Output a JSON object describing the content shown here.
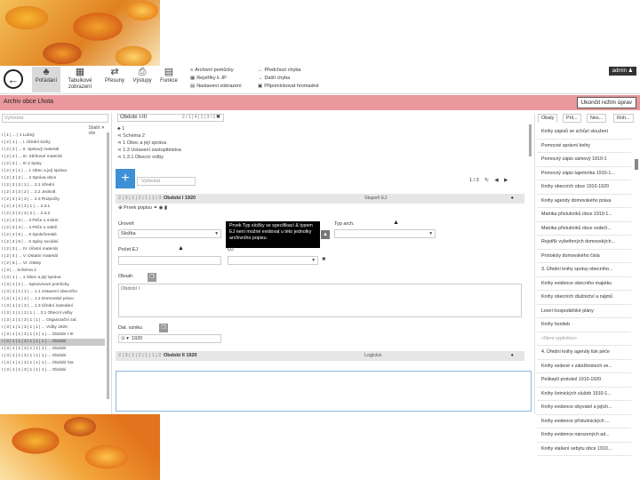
{
  "toolbar": {
    "buttons": [
      {
        "label": "Pořádání",
        "icon": "hierarchy-icon"
      },
      {
        "label": "Tabulkové zobrazení",
        "icon": "table-icon"
      },
      {
        "label": "Přesuny",
        "icon": "transfer-icon"
      },
      {
        "label": "Výstupy",
        "icon": "printer-icon"
      },
      {
        "label": "Funkce",
        "icon": "calculator-icon"
      }
    ],
    "links": [
      {
        "label": "Archivní pomůcky"
      },
      {
        "label": "Rejstříky k JP"
      },
      {
        "label": "Nastavení zobrazení"
      },
      {
        "label": "Předchozí chyba"
      },
      {
        "label": "Další chyba"
      },
      {
        "label": "Připomínkovat hromadně"
      }
    ],
    "user": "admin"
  },
  "titlebar": {
    "title": "Archiv obce Lhota",
    "end_edit": "Ukončit režim úprav"
  },
  "tree": {
    "search_placeholder": "Vyhledat",
    "collapse_label": "Sbalit vše",
    "rows": [
      "I | 1 | ... | 1 Lubný",
      "I | 2 | 1 | ... I. Úřední knihy",
      "I | 2 | 2 | ... II. Spisový materiál",
      "I | 2 | 2 | ... III. Sbírkové materiál",
      "I | 2 | 2 | ... III 2 Spisy",
      "I | 2 | 2 | 1 | ... 1 Obec a její správa",
      "I | 2 | 2 | 2 | ... 2 Správa obce",
      "I | 2 | 2 | 2 | 1 | ... 2.1 Úřední",
      "I | 2 | 2 | 2 | 2 | ... 2.2 Jednotl.",
      "I | 2 | 2 | 2 | 3 | ... 2.3 Rozpočty",
      "I | 2 | 2 | 2 | 3 | 1 | ... 2.3.1",
      "I | 2 | 2 | 2 | 3 | 2 | ... 2.3.2",
      "I | 2 | 2 | 3 | ... 3 Péče o místní",
      "I | 2 | 2 | 4 | ... 4 Péče o nálež.",
      "I | 2 | 2 | 5 | ... 5 Společenské",
      "I | 2 | 2 | 6 | ... 6 Spisy sociální",
      "I | 2 | 3 | ... IV. Účetní materiál",
      "I | 2 | 4 | ... V. Ostatní materiál",
      "I | 2 | 5 | ... VI. Otisky",
      "I | 3 | ... Schéma 2",
      "I | 3 | 1 | ... 1 Obec a její správa",
      "I | 3 | 1 | 1 | ... Spisovnové pomůcky",
      "I | 3 | 1 | 1 | 1 | ... 1.1 Ustavení obecního",
      "I | 3 | 1 | 1 | 2 | ... 1.2 Domovské právo",
      "I | 3 | 1 | 1 | 3 | ... 1.3 Úřední zasedání",
      "I | 3 | 1 | 1 | 3 | 1 | ... 3.1 Obecní volby",
      "I | 3 | 1 | 1 | 3 | 1 | 1 | ... Organizační zal.",
      "I | 3 | 1 | 1 | 3 | 1 | 1 | ... Volby 1920",
      "I | 3 | 1 | 1 | 3 | 1 | 1 | 1 | ... Období I-III",
      "I | 3 | 1 | 1 | 3 | 1 | 1 | 1 | ... Období",
      "I | 3 | 1 | 1 | 3 | 1 | 1 | 1 | ... Období",
      "I | 3 | 1 | 1 | 3 | 1 | 1 | 1 | ... Období",
      "I | 3 | 1 | 1 | 3 | 1 | 1 | 1 | ... Období IVa",
      "I | 3 | 1 | 1 | 3 | 1 | 1 | 1 | ... Období"
    ]
  },
  "center": {
    "tab_label": "Období I-III",
    "tab_number": "2 / 1 | 4 | 1 | 3 / 1",
    "breadcrumb": [
      "1",
      "Schéma 2",
      "1 Obec a její správa",
      "1.3 Ustavení zastupitelstva",
      "1.3.1 Obecní volby"
    ],
    "filter_placeholder": "Vyhledat",
    "pager": [
      "1 / 3",
      "↻",
      "◀",
      "▶"
    ],
    "card1": {
      "path": "2 | 3 | 1 | 2 | 1 | 1 | 3",
      "name": "Období I 1920",
      "type": "Stupeň EJ"
    },
    "perm_label": "Prvek popisu",
    "uroven_label": "Úroveň",
    "uroven_value": "Složka",
    "typarch_label": "Typ arch.",
    "pocet_label": "Počet EJ",
    "uj_label": "UJ",
    "obsah_label": "Obsah",
    "obsah_value": "Období I",
    "datace_label": "Dat. vzniku",
    "datace_value": "1920",
    "tooltip": "Prvek Typ složky se specifikací & typem EJ není možné evidovat u této jednotky archivního popisu.",
    "card2": {
      "path": "2 | 3 | 1 | 2 | 1 | 1 | 2",
      "name": "Období II 1920",
      "type": "Logická"
    }
  },
  "right": {
    "tabs": [
      "Obaly",
      "Pril...",
      "Nes...",
      "Roh..."
    ],
    "items": [
      "Knihy zápisů ve schůzí sloužení",
      "Pomocné správní knihy",
      "Pomocný zápis sámový 1910-1",
      "Pomocný zápis tajemníka 1910-1...",
      "Knihy obecních obce 1910-1920",
      "Knihy agendy domovského práva",
      "Matrika příslušníků obce 1910-1...",
      "Matrika příslušníků obce ovdečí...",
      "Rejstřík vyšetřených domovských...",
      "Protokoly domovského čisla",
      "3. Úřední knihy správy obecního...",
      "Knihy evidence obecního majetku",
      "Knihy obecních dlužnictví a nájmů",
      "Lesní hospodářské plány",
      "Knihy honiteb",
      "<Není vyplněno>",
      "4. Úřední knihy agendy tisk péče",
      "Knihy vedené v záležitostech ve...",
      "Pelikeplí protokol 1910-1920",
      "Knihy četnických služeb 1910-1...",
      "Knihy evidence obyvatel a jejich...",
      "Knihy evidence příslušnických ...",
      "Knihy evidence narozených ad...",
      "Knihy vlašení sebytu obce 1910..."
    ]
  },
  "colors": {
    "accent": "#3d8fd6",
    "titlebar": "#e9989b"
  }
}
